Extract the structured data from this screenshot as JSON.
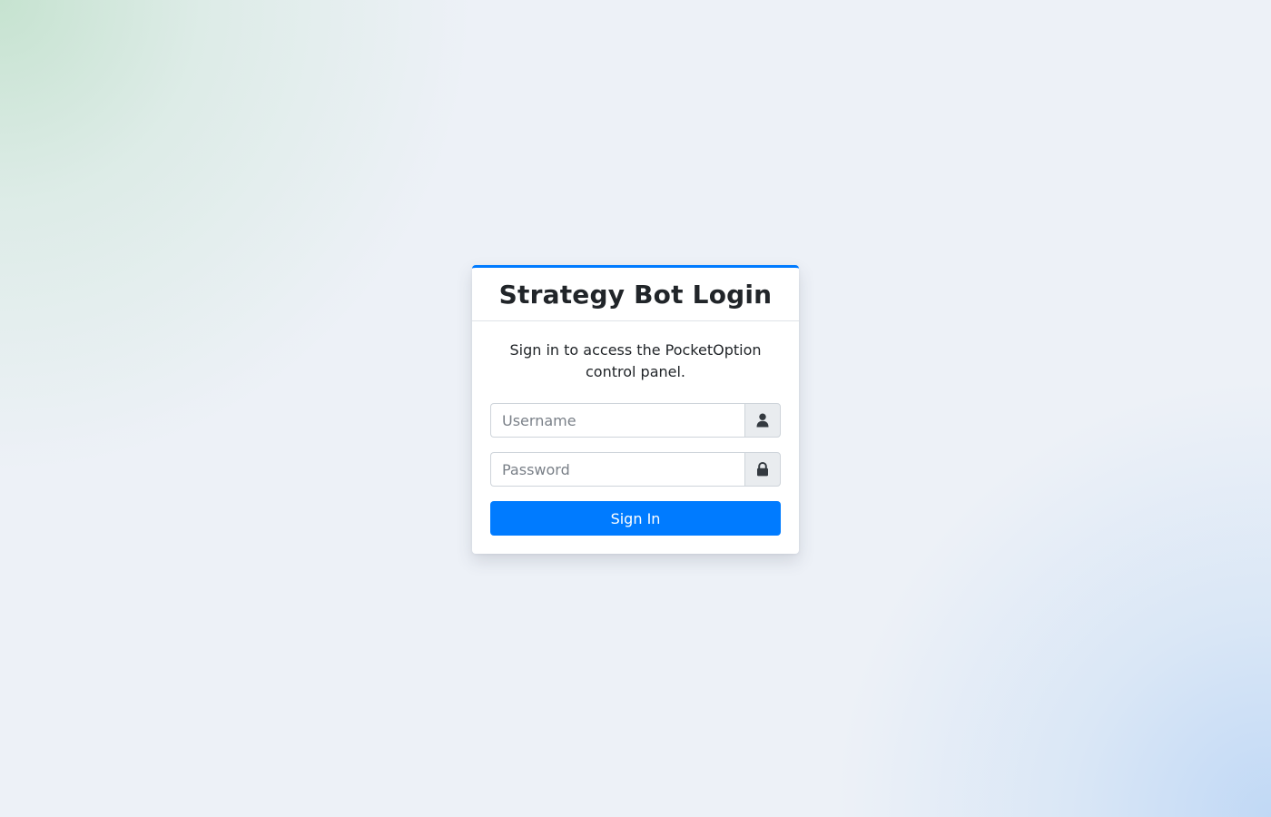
{
  "colors": {
    "accent": "#007bff",
    "title_text": "#212529",
    "addon_background": "#e9ecef",
    "icon_color": "#343a40"
  },
  "login": {
    "title": "Strategy Bot Login",
    "subtitle": "Sign in to access the PocketOption control panel.",
    "username": {
      "placeholder": "Username",
      "value": "",
      "icon": "user-icon"
    },
    "password": {
      "placeholder": "Password",
      "value": "",
      "icon": "lock-icon"
    },
    "submit_label": "Sign In"
  }
}
